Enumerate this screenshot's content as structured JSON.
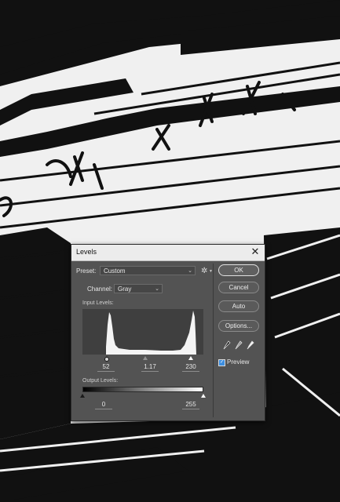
{
  "dialog": {
    "title": "Levels",
    "close_glyph": "✕",
    "preset": {
      "label": "Preset:",
      "value": "Custom"
    },
    "channel": {
      "label": "Channel:",
      "value": "Gray"
    },
    "input_levels": {
      "label": "Input Levels:",
      "black": "52",
      "mid": "1.17",
      "white": "230"
    },
    "output_levels": {
      "label": "Output Levels:",
      "black": "0",
      "white": "255"
    },
    "buttons": {
      "ok": "OK",
      "cancel": "Cancel",
      "auto": "Auto",
      "options": "Options..."
    },
    "preview": {
      "label": "Preview",
      "checked": true
    },
    "icons": [
      "gear-icon",
      "eyedropper-black-icon",
      "eyedropper-gray-icon",
      "eyedropper-white-icon"
    ],
    "colors": {
      "dialog_bg": "#535353",
      "accent": "#3d8ee0"
    }
  }
}
